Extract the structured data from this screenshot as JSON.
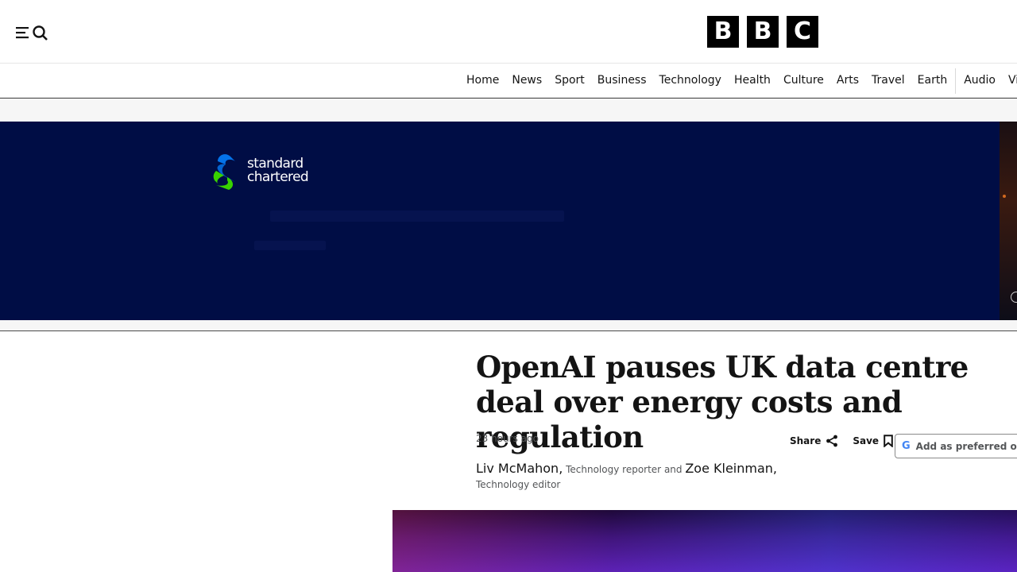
{
  "masthead": {
    "menu_icon": "menu-icon",
    "search_icon": "search-icon",
    "logo_letters": [
      "B",
      "B",
      "C"
    ]
  },
  "nav": {
    "items": [
      "Home",
      "News",
      "Sport",
      "Business",
      "Technology",
      "Health",
      "Culture",
      "Arts",
      "Travel",
      "Earth",
      "Audio",
      "Video"
    ]
  },
  "ad": {
    "brand_line1": "standard",
    "brand_line2": "chartered",
    "background_color": "#000d45"
  },
  "article": {
    "headline": "OpenAI pauses UK data centre deal over energy costs and regulation",
    "timestamp": "23 hours ago",
    "share_label": "Share",
    "share_icon": "share-icon",
    "save_label": "Save",
    "save_icon": "bookmark-icon",
    "preferred_label": "Add as preferred on Google",
    "preferred_icon": "google-icon",
    "byline": {
      "author1": "Liv McMahon,",
      "role1": "Technology reporter",
      "conjunction": "and",
      "author2": "Zoe Kleinman,",
      "role2": "Technology editor"
    }
  }
}
